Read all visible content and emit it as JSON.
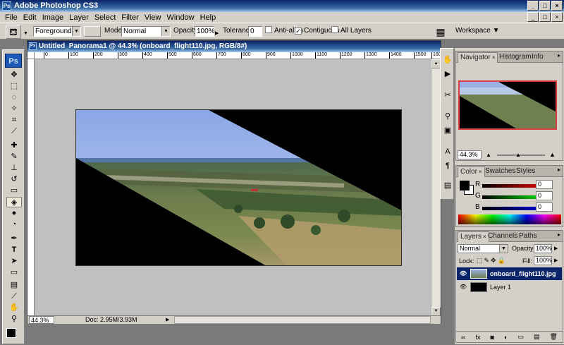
{
  "app": {
    "title": "Adobe Photoshop CS3",
    "logo": "Ps"
  },
  "window_controls": {
    "minimize": "_",
    "maximize": "□",
    "close": "×"
  },
  "menu": [
    "File",
    "Edit",
    "Image",
    "Layer",
    "Select",
    "Filter",
    "View",
    "Window",
    "Help"
  ],
  "options": {
    "fill_source": "Foreground",
    "mode_label": "Mode:",
    "mode_value": "Normal",
    "opacity_label": "Opacity:",
    "opacity_value": "100%",
    "tolerance_label": "Tolerance:",
    "tolerance_value": "0",
    "anti_alias_label": "Anti-alias",
    "anti_alias_checked": false,
    "contiguous_label": "Contiguous",
    "contiguous_checked": true,
    "all_layers_label": "All Layers",
    "all_layers_checked": false,
    "workspace_label": "Workspace ▼"
  },
  "document": {
    "title": "Untitled_Panorama1 @ 44.3% (onboard_flight110.jpg, RGB/8#)",
    "ruler_ticks": [
      "0",
      "100",
      "200",
      "300",
      "400",
      "500",
      "600",
      "700",
      "800",
      "900",
      "1000",
      "1100",
      "1200",
      "1300",
      "1400",
      "1500",
      "160"
    ],
    "status_zoom": "44.3%",
    "status_doc": "Doc: 2.95M/3.93M"
  },
  "panels": {
    "navigator": {
      "tabs": [
        "Navigator",
        "Histogram",
        "Info"
      ],
      "zoom": "44.3%"
    },
    "color": {
      "tabs": [
        "Color",
        "Swatches",
        "Styles"
      ],
      "channels": [
        {
          "label": "R",
          "value": "0"
        },
        {
          "label": "G",
          "value": "0"
        },
        {
          "label": "B",
          "value": "0"
        }
      ]
    },
    "layers": {
      "tabs": [
        "Layers",
        "Channels",
        "Paths"
      ],
      "blend_mode": "Normal",
      "opacity_label": "Opacity:",
      "opacity_value": "100%",
      "lock_label": "Lock:",
      "fill_label": "Fill:",
      "fill_value": "100%",
      "layers": [
        {
          "name": "onboard_flight110.jpg",
          "selected": true
        },
        {
          "name": "Layer 1",
          "selected": false
        }
      ]
    }
  },
  "colors": {
    "title_bar": "#0a246a",
    "chrome": "#d4d0c8",
    "canvas_bg": "#c0c0c0",
    "selected_layer": "#0a246a"
  }
}
